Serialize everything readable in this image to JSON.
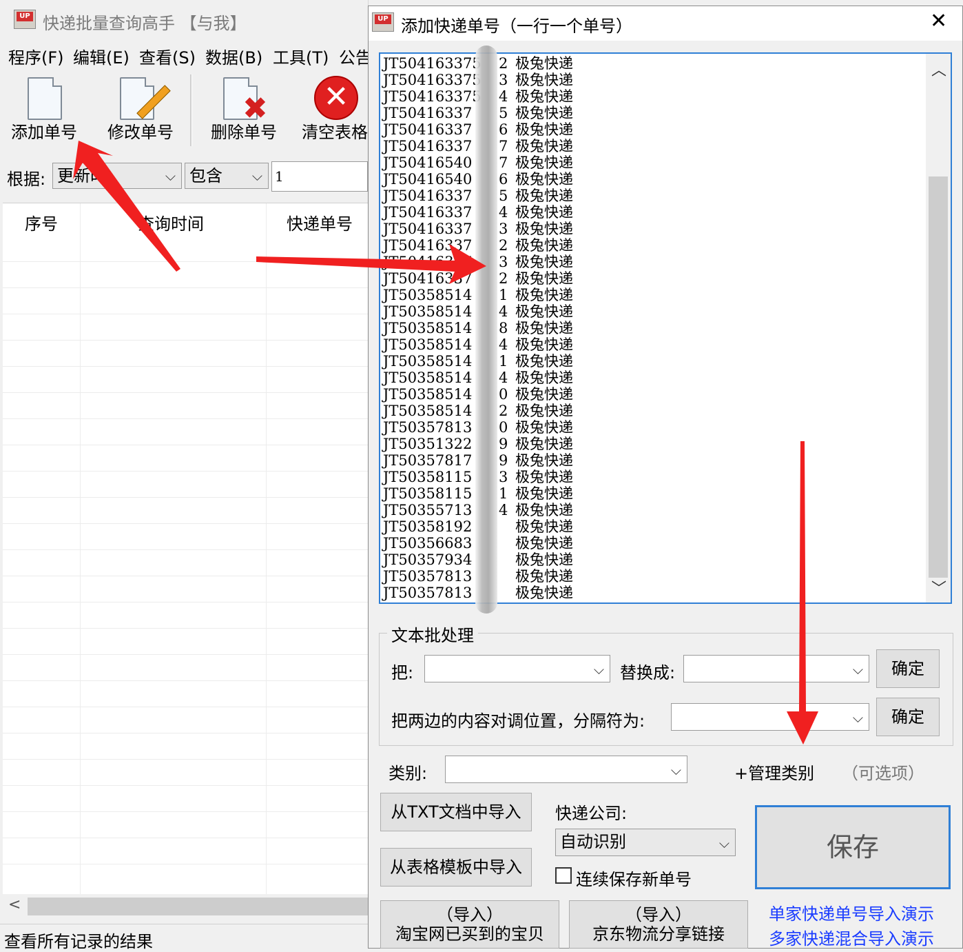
{
  "main_window": {
    "title": "快递批量查询高手 【与我】",
    "menu": [
      "程序(F)",
      "编辑(E)",
      "查看(S)",
      "数据(B)",
      "工具(T)",
      "公告"
    ],
    "toolbar": {
      "add": "添加单号",
      "edit": "修改单号",
      "delete": "删除单号",
      "clear": "清空表格"
    },
    "filter": {
      "label": "根据:",
      "field": "更新时",
      "mode": "包含",
      "value": "1"
    },
    "grid_headers": [
      "序号",
      "查询时间",
      "快递单号"
    ],
    "status": "查看所有记录的结果"
  },
  "dialog": {
    "title": "添加快递单号（一行一个单号）",
    "close": "✕",
    "entries": [
      {
        "num": "JT504163375",
        "suf": "2",
        "co": "极兔快递"
      },
      {
        "num": "JT504163375",
        "suf": "3",
        "co": "极兔快递"
      },
      {
        "num": "JT504163375",
        "suf": "4",
        "co": "极兔快递"
      },
      {
        "num": "JT50416337",
        "suf": "5",
        "co": "极兔快递"
      },
      {
        "num": "JT50416337",
        "suf": "6",
        "co": "极兔快递"
      },
      {
        "num": "JT50416337",
        "suf": "7",
        "co": "极兔快递"
      },
      {
        "num": "JT50416540",
        "suf": "7",
        "co": "极兔快递"
      },
      {
        "num": "JT50416540",
        "suf": "6",
        "co": "极兔快递"
      },
      {
        "num": "JT50416337",
        "suf": "5",
        "co": "极兔快递"
      },
      {
        "num": "JT50416337",
        "suf": "4",
        "co": "极兔快递"
      },
      {
        "num": "JT50416337",
        "suf": "3",
        "co": "极兔快递"
      },
      {
        "num": "JT50416337",
        "suf": "2",
        "co": "极兔快递"
      },
      {
        "num": "JT50416337",
        "suf": "3",
        "co": "极兔快递"
      },
      {
        "num": "JT50416337",
        "suf": "2",
        "co": "极兔快递"
      },
      {
        "num": "JT50358514",
        "suf": "1",
        "co": "极兔快递"
      },
      {
        "num": "JT50358514",
        "suf": "4",
        "co": "极兔快递"
      },
      {
        "num": "JT50358514",
        "suf": "8",
        "co": "极兔快递"
      },
      {
        "num": "JT50358514",
        "suf": "4",
        "co": "极兔快递"
      },
      {
        "num": "JT50358514",
        "suf": "1",
        "co": "极兔快递"
      },
      {
        "num": "JT50358514",
        "suf": "4",
        "co": "极兔快递"
      },
      {
        "num": "JT50358514",
        "suf": "0",
        "co": "极兔快递"
      },
      {
        "num": "JT50358514",
        "suf": "2",
        "co": "极兔快递"
      },
      {
        "num": "JT50357813",
        "suf": "0",
        "co": "极兔快递"
      },
      {
        "num": "JT50351322",
        "suf": "9",
        "co": "极兔快递"
      },
      {
        "num": "JT50357817",
        "suf": "9",
        "co": "极兔快递"
      },
      {
        "num": "JT50358115",
        "suf": "3",
        "co": "极兔快递"
      },
      {
        "num": "JT50358115",
        "suf": "1",
        "co": "极兔快递"
      },
      {
        "num": "JT50355713",
        "suf": "4",
        "co": "极兔快递"
      },
      {
        "num": "JT50358192",
        "suf": "",
        "co": "极兔快递"
      },
      {
        "num": "JT50356683",
        "suf": "",
        "co": "极兔快递"
      },
      {
        "num": "JT50357934",
        "suf": "",
        "co": "极兔快递"
      },
      {
        "num": "JT50357813",
        "suf": "",
        "co": "极兔快递"
      },
      {
        "num": "JT50357813",
        "suf": "",
        "co": "极兔快递"
      }
    ],
    "batch": {
      "group_title": "文本批处理",
      "from_label": "把:",
      "to_label": "替换成:",
      "confirm1": "确定",
      "swap_label": "把两边的内容对调位置，分隔符为:",
      "confirm2": "确定"
    },
    "category_label": "类别:",
    "manage_category": "+管理类别",
    "optional": "（可选项）",
    "import_txt": "从TXT文档中导入",
    "import_template": "从表格模板中导入",
    "courier_label": "快递公司:",
    "courier_value": "自动识别",
    "continuous_save": "连续保存新单号",
    "save": "保存",
    "taobao_line1": "（导入）",
    "taobao_line2": "淘宝网已买到的宝贝",
    "jd_line1": "（导入）",
    "jd_line2": "京东物流分享链接",
    "demo_single": "单家快递单号导入演示",
    "demo_multi": "多家快递混合导入演示"
  },
  "colors": {
    "accent": "#2f7fd6",
    "arrow": "#f02020",
    "link": "#1a3cff"
  }
}
